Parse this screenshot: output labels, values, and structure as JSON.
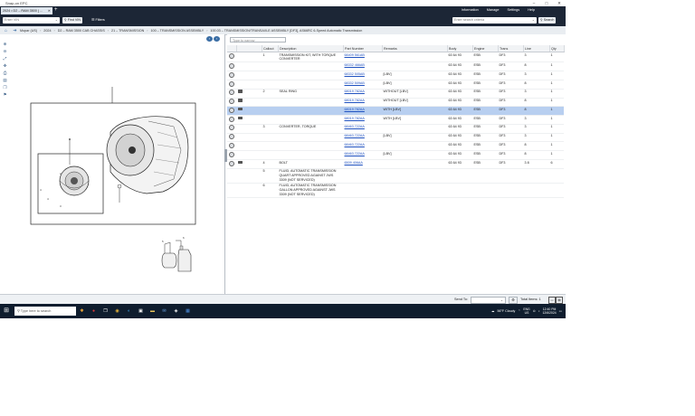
{
  "window": {
    "title": "Snap-on EPC",
    "controls": [
      "–",
      "□",
      "✕"
    ]
  },
  "tab": {
    "label": "2024 • D2 – RAM 3500 ( ...",
    "close": "✕",
    "new_tab": "+"
  },
  "top_menu": [
    "Information",
    "Manage",
    "Settings",
    "Help"
  ],
  "toolbar": {
    "vin_placeholder": "Enter VIN",
    "find_vin_label": "Find VIN",
    "filters_label": "Filters",
    "search_placeholder": "Enter search criteria",
    "search_button_label": "Search"
  },
  "breadcrumb": [
    "Mopar (US)",
    "2024",
    "D2 – RAM 3500 CAB CHASSIS",
    "21 – TRANSMISSION",
    "100 – TRANSMISSION ASSEMBLY",
    "100.03 – TRANSMISSION/TRANSAXLE ASSEMBLY [DF3], AS66RC 6-Speed Automatic Transmission"
  ],
  "parts": {
    "filter_placeholder": "Type to narrow",
    "columns": [
      "",
      "",
      "Callout",
      "Description",
      "Part Number",
      "Remarks",
      "Body",
      "Engine",
      "Trans",
      "Line",
      "Qty"
    ],
    "rows": [
      {
        "camera": false,
        "callout": "1",
        "description": "TRANSMISSION KIT, WITH TORQUE CONVERTER",
        "part": "68409 561AB",
        "remarks": "",
        "body": "63 64 93",
        "engine": "ESB",
        "trans": "DF3",
        "line": "3",
        "qty": "1",
        "selected": false
      },
      {
        "camera": false,
        "callout": "",
        "description": "",
        "part": "68332 466AB",
        "remarks": "",
        "body": "63 64 93",
        "engine": "ESB",
        "trans": "DF3",
        "line": "8",
        "qty": "1",
        "selected": false
      },
      {
        "camera": false,
        "callout": "",
        "description": "",
        "part": "68332 505AB",
        "remarks": "[LBV]",
        "body": "63 64 93",
        "engine": "ESB",
        "trans": "DF3",
        "line": "3",
        "qty": "1",
        "selected": false
      },
      {
        "camera": false,
        "callout": "",
        "description": "",
        "part": "68332 509AB",
        "remarks": "[LBV]",
        "body": "63 64 93",
        "engine": "ESB",
        "trans": "DF3",
        "line": "8",
        "qty": "1",
        "selected": false
      },
      {
        "camera": true,
        "callout": "2",
        "description": "SEAL RING",
        "part": "68019 782AA",
        "remarks": "WITHOUT [LBV]",
        "body": "63 64 93",
        "engine": "ESB",
        "trans": "DF3",
        "line": "3",
        "qty": "1",
        "selected": false
      },
      {
        "camera": true,
        "callout": "",
        "description": "",
        "part": "68019 782AA",
        "remarks": "WITHOUT [LBV]",
        "body": "63 64 93",
        "engine": "ESB",
        "trans": "DF3",
        "line": "8",
        "qty": "1",
        "selected": false
      },
      {
        "camera": true,
        "callout": "",
        "description": "",
        "part": "68019 782AA",
        "remarks": "WITH [LBV]",
        "body": "63 64 93",
        "engine": "ESB",
        "trans": "DF3",
        "line": "8",
        "qty": "1",
        "selected": true
      },
      {
        "camera": true,
        "callout": "",
        "description": "",
        "part": "68019 782AA",
        "remarks": "WITH [LBV]",
        "body": "63 64 93",
        "engine": "ESB",
        "trans": "DF3",
        "line": "3",
        "qty": "1",
        "selected": false
      },
      {
        "camera": false,
        "callout": "3",
        "description": "CONVERTER, TORQUE",
        "part": "68463 722AA",
        "remarks": "",
        "body": "63 64 93",
        "engine": "ESB",
        "trans": "DF3",
        "line": "3",
        "qty": "1",
        "selected": false
      },
      {
        "camera": false,
        "callout": "",
        "description": "",
        "part": "68463 722AA",
        "remarks": "[LBV]",
        "body": "63 64 93",
        "engine": "ESB",
        "trans": "DF3",
        "line": "3",
        "qty": "1",
        "selected": false
      },
      {
        "camera": false,
        "callout": "",
        "description": "",
        "part": "68463 722AA",
        "remarks": "",
        "body": "63 64 93",
        "engine": "ESB",
        "trans": "DF3",
        "line": "8",
        "qty": "1",
        "selected": false
      },
      {
        "camera": false,
        "callout": "",
        "description": "",
        "part": "68463 722AA",
        "remarks": "[LBV]",
        "body": "63 64 93",
        "engine": "ESB",
        "trans": "DF3",
        "line": "8",
        "qty": "1",
        "selected": false
      },
      {
        "camera": true,
        "callout": "4",
        "description": "BOLT",
        "part": "6509 406AA",
        "remarks": "",
        "body": "63 64 93",
        "engine": "ESB",
        "trans": "DF3",
        "line": "3 8",
        "qty": "6",
        "selected": false
      }
    ],
    "notes": [
      {
        "callout": "5",
        "description": "FLUID, AUTOMATIC TRANSMISSION QUART APPROVED AGAINST JWS 3309 (NOT SERVICED)"
      },
      {
        "callout": "6",
        "description": "FLUID, AUTOMATIC TRANSMISSION GALLON APPROVED AGAINST JWS 3309 (NOT SERVICED)"
      }
    ]
  },
  "status": {
    "send_to_label": "Send To:",
    "total_items_label": "Total Items: 1"
  },
  "taskbar": {
    "search_placeholder": "Type here to search",
    "weather": "56°F  Cloudy",
    "lang": "ENG",
    "region": "US",
    "time": "12:40 PM",
    "date": "12/6/2024"
  }
}
